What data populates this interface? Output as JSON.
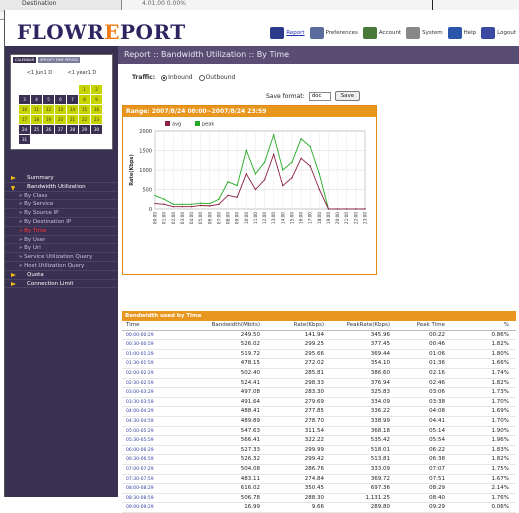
{
  "background_window": {
    "fragment": "Destination",
    "fragment2": "4.01.00  0.00%"
  },
  "logo": {
    "part1": "FLOWR",
    "part2": "E",
    "part3": "PORT"
  },
  "nav": [
    {
      "label": "Report",
      "icon": "bar-chart-icon",
      "color": "#2c3a8c"
    },
    {
      "label": "Preferences",
      "icon": "preferences-icon",
      "color": "#5a6c9c"
    },
    {
      "label": "Account",
      "icon": "account-icon",
      "color": "#4a7a3a"
    },
    {
      "label": "System",
      "icon": "system-icon",
      "color": "#888888"
    },
    {
      "label": "Help",
      "icon": "help-icon",
      "color": "#2a55aa"
    },
    {
      "label": "Logout",
      "icon": "logout-icon",
      "color": "#3a4aa0"
    }
  ],
  "calendar": {
    "tabs": [
      "CALENDAR",
      "SPECIFY TIME PERIOD"
    ],
    "prev_month": "<1 Jun1 D",
    "prev_year": "<1 year1 D",
    "weeks": [
      [
        "",
        "",
        "",
        "",
        "",
        "1",
        "2"
      ],
      [
        "3",
        "4",
        "5",
        "6",
        "7",
        "8",
        "9"
      ],
      [
        "10",
        "11",
        "12",
        "13",
        "14",
        "15",
        "16"
      ],
      [
        "17",
        "18",
        "19",
        "20",
        "21",
        "22",
        "23"
      ],
      [
        "24",
        "25",
        "26",
        "27",
        "28",
        "29",
        "30"
      ],
      [
        "31",
        "",
        "",
        "",
        "",
        "",
        ""
      ]
    ]
  },
  "menu": [
    {
      "label": "Summary",
      "kind": "top"
    },
    {
      "label": "Bandwidth Utilization",
      "kind": "top-open"
    },
    {
      "label": "By Class",
      "kind": "sub"
    },
    {
      "label": "By Service",
      "kind": "sub"
    },
    {
      "label": "By Source IP",
      "kind": "sub"
    },
    {
      "label": "By Destination IP",
      "kind": "sub"
    },
    {
      "label": "By Time",
      "kind": "sub-active"
    },
    {
      "label": "By User",
      "kind": "sub"
    },
    {
      "label": "By Url",
      "kind": "sub"
    },
    {
      "label": "Service Utilization Query",
      "kind": "sub"
    },
    {
      "label": "Host Utilization Query",
      "kind": "sub"
    },
    {
      "label": "Quota",
      "kind": "top"
    },
    {
      "label": "Connection Limit",
      "kind": "top"
    }
  ],
  "breadcrumb": "Report :: Bandwidth Utilization :: By Time",
  "traffic": {
    "label": "Traffic:",
    "options": [
      "Inbound",
      "Outbound"
    ],
    "selected": "Inbound"
  },
  "save": {
    "label": "Save format:",
    "format": "doc",
    "button": "Save"
  },
  "range_header": "Range: 2007/8/24 00:00~2007/8/24 23:59",
  "chart_data": {
    "type": "line",
    "ylabel": "Rate(Kbps)",
    "ylim": [
      0,
      2000
    ],
    "yticks": [
      0,
      500,
      1000,
      1500,
      2000
    ],
    "x": [
      "00:00",
      "01:00",
      "02:00",
      "03:00",
      "04:00",
      "05:00",
      "06:00",
      "07:00",
      "08:00",
      "09:00",
      "10:00",
      "11:00",
      "12:00",
      "13:00",
      "14:00",
      "15:00",
      "16:00",
      "17:00",
      "18:00",
      "19:00",
      "20:00",
      "21:00",
      "22:00",
      "23:00"
    ],
    "series": [
      {
        "name": "avg",
        "color": "#8b2040",
        "values": [
          140,
          120,
          60,
          60,
          60,
          90,
          80,
          120,
          350,
          300,
          900,
          500,
          750,
          1400,
          600,
          800,
          1300,
          1100,
          500,
          0,
          0,
          0,
          0,
          0
        ]
      },
      {
        "name": "peak",
        "color": "#22aa22",
        "values": [
          345,
          250,
          120,
          120,
          120,
          150,
          140,
          250,
          700,
          600,
          1500,
          900,
          1200,
          1900,
          1000,
          1200,
          1800,
          1600,
          900,
          0,
          0,
          0,
          0,
          0
        ]
      }
    ],
    "grid": true,
    "legend": "top-left"
  },
  "table": {
    "title": "Bandwidth used by Time",
    "columns": [
      "Time",
      "Bandwidth(Mbits)",
      "Rate(Kbps)",
      "PeakRate(Kbps)",
      "Peak Time",
      "%"
    ],
    "rows": [
      [
        "00:00-00:29",
        "249.50",
        "141.94",
        "345.96",
        "00:22",
        "0.86%"
      ],
      [
        "00:30-00:59",
        "526.02",
        "299.25",
        "377.45",
        "00:46",
        "1.82%"
      ],
      [
        "01:00-01:29",
        "519.72",
        "295.66",
        "369.44",
        "01:06",
        "1.80%"
      ],
      [
        "01:30-01:59",
        "478.15",
        "272.02",
        "354.10",
        "01:36",
        "1.66%"
      ],
      [
        "02:00-02:29",
        "502.40",
        "285.81",
        "386.60",
        "02:16",
        "1.74%"
      ],
      [
        "02:30-02:59",
        "524.41",
        "298.33",
        "376.94",
        "02:46",
        "1.82%"
      ],
      [
        "03:00-03:29",
        "497.08",
        "283.30",
        "325.83",
        "03:06",
        "1.73%"
      ],
      [
        "03:30-03:59",
        "491.64",
        "279.69",
        "334.09",
        "03:38",
        "1.70%"
      ],
      [
        "04:00-04:29",
        "488.41",
        "277.85",
        "336.22",
        "04:08",
        "1.69%"
      ],
      [
        "04:30-04:59",
        "489.89",
        "278.70",
        "338.99",
        "04:41",
        "1.70%"
      ],
      [
        "05:00-05:29",
        "547.63",
        "311.54",
        "368.18",
        "05:14",
        "1.90%"
      ],
      [
        "05:30-05:59",
        "566.41",
        "322.22",
        "535.42",
        "05:54",
        "1.96%"
      ],
      [
        "06:00-06:29",
        "527.33",
        "299.99",
        "518.01",
        "06:22",
        "1.83%"
      ],
      [
        "06:30-06:59",
        "526.32",
        "299.42",
        "513.81",
        "06:38",
        "1.82%"
      ],
      [
        "07:00-07:29",
        "504.08",
        "286.76",
        "333.09",
        "07:07",
        "1.75%"
      ],
      [
        "07:30-07:59",
        "483.11",
        "274.84",
        "369.72",
        "07:51",
        "1.67%"
      ],
      [
        "08:00-08:29",
        "616.02",
        "350.45",
        "697.36",
        "08:29",
        "2.14%"
      ],
      [
        "08:30-08:59",
        "506.78",
        "288.30",
        "1,131.25",
        "08:40",
        "1.76%"
      ],
      [
        "09:00-09:29",
        "16.99",
        "9.66",
        "289.80",
        "09:29",
        "0.06%"
      ]
    ]
  }
}
